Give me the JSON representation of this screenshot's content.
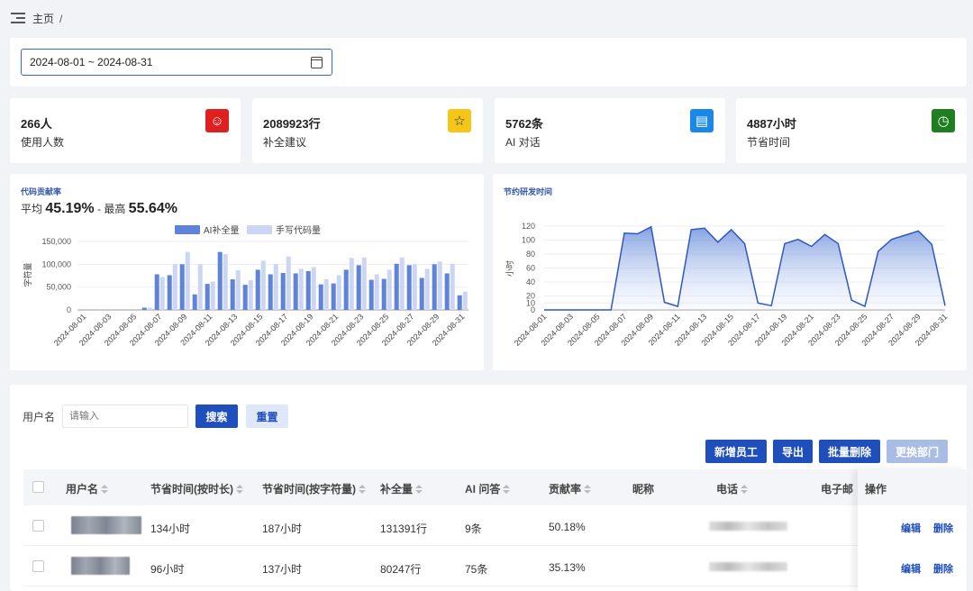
{
  "breadcrumb": {
    "home": "主页",
    "separator": "/"
  },
  "date_range": "2024-08-01 ~ 2024-08-31",
  "stats": [
    {
      "value": "266人",
      "label": "使用人数",
      "color": "#e02020",
      "icon": "user-circle-icon",
      "glyph": "☺"
    },
    {
      "value": "2089923行",
      "label": "补全建议",
      "color": "#f5c518",
      "icon": "star-icon",
      "glyph": "☆"
    },
    {
      "value": "5762条",
      "label": "AI 对话",
      "color": "#1a88e8",
      "icon": "chat-icon",
      "glyph": "▤"
    },
    {
      "value": "4887小时",
      "label": "节省时间",
      "color": "#1e7e20",
      "icon": "clock-icon",
      "glyph": "◷"
    }
  ],
  "contribution": {
    "title": "代码贡献率",
    "avg_label": "平均",
    "avg_value": "45.19%",
    "dash": "-",
    "max_label": "最高",
    "max_value": "55.64%"
  },
  "time_saved": {
    "title": "节约研发时间"
  },
  "colors": {
    "primary": "#1f4ebd",
    "bar_ai": "#5f83d9",
    "bar_manual": "#ccd6f3",
    "line": "#2f57c4"
  },
  "chart_data": [
    {
      "type": "bar",
      "categories": [
        "2024-08-01",
        "2024-08-02",
        "2024-08-03",
        "2024-08-04",
        "2024-08-05",
        "2024-08-06",
        "2024-08-07",
        "2024-08-08",
        "2024-08-09",
        "2024-08-10",
        "2024-08-11",
        "2024-08-12",
        "2024-08-13",
        "2024-08-14",
        "2024-08-15",
        "2024-08-16",
        "2024-08-17",
        "2024-08-18",
        "2024-08-19",
        "2024-08-20",
        "2024-08-21",
        "2024-08-22",
        "2024-08-23",
        "2024-08-24",
        "2024-08-25",
        "2024-08-26",
        "2024-08-27",
        "2024-08-28",
        "2024-08-29",
        "2024-08-30",
        "2024-08-31"
      ],
      "tick_labels": [
        "2024-08-01",
        "2024-08-03",
        "2024-08-05",
        "2024-08-07",
        "2024-08-09",
        "2024-08-11",
        "2024-08-13",
        "2024-08-15",
        "2024-08-17",
        "2024-08-19",
        "2024-08-21",
        "2024-08-23",
        "2024-08-25",
        "2024-08-27",
        "2024-08-29",
        "2024-08-31"
      ],
      "series": [
        {
          "name": "AI补全量",
          "values": [
            0,
            0,
            0,
            0,
            0,
            5000,
            78000,
            76000,
            100000,
            34000,
            57000,
            127000,
            67000,
            55000,
            88000,
            78000,
            81000,
            80000,
            85000,
            56000,
            58000,
            88000,
            98000,
            66000,
            68000,
            101000,
            98000,
            70000,
            100000,
            80000,
            32000
          ]
        },
        {
          "name": "手写代码量",
          "values": [
            0,
            0,
            0,
            0,
            0,
            5000,
            72000,
            100000,
            127000,
            100000,
            62000,
            122000,
            87000,
            65000,
            108000,
            100000,
            117000,
            90000,
            94000,
            67000,
            76000,
            114000,
            115000,
            78000,
            88000,
            115000,
            100000,
            90000,
            106000,
            101000,
            40000
          ]
        }
      ],
      "ylabel": "字符量",
      "yticks": [
        "0",
        "50,000",
        "100,000",
        "150,000"
      ],
      "ylim": [
        0,
        150000
      ]
    },
    {
      "type": "area",
      "x": [
        "2024-08-01",
        "2024-08-02",
        "2024-08-03",
        "2024-08-04",
        "2024-08-05",
        "2024-08-06",
        "2024-08-07",
        "2024-08-08",
        "2024-08-09",
        "2024-08-10",
        "2024-08-11",
        "2024-08-12",
        "2024-08-13",
        "2024-08-14",
        "2024-08-15",
        "2024-08-16",
        "2024-08-17",
        "2024-08-18",
        "2024-08-19",
        "2024-08-20",
        "2024-08-21",
        "2024-08-22",
        "2024-08-23",
        "2024-08-24",
        "2024-08-25",
        "2024-08-26",
        "2024-08-27",
        "2024-08-28",
        "2024-08-29",
        "2024-08-30",
        "2024-08-31"
      ],
      "tick_labels": [
        "2024-08-01",
        "2024-08-03",
        "2024-08-05",
        "2024-08-07",
        "2024-08-09",
        "2024-08-11",
        "2024-08-13",
        "2024-08-15",
        "2024-08-17",
        "2024-08-19",
        "2024-08-21",
        "2024-08-23",
        "2024-08-25",
        "2024-08-27",
        "2024-08-29",
        "2024-08-31"
      ],
      "series": [
        {
          "values": [
            0,
            0,
            0,
            0,
            0,
            0,
            110,
            109,
            119,
            11,
            5,
            115,
            117,
            97,
            115,
            95,
            10,
            6,
            95,
            101,
            91,
            108,
            95,
            14,
            5,
            84,
            101,
            107,
            113,
            94,
            6
          ]
        }
      ],
      "ylabel": "小时",
      "yticks": [
        "0",
        "10",
        "20",
        "40",
        "60",
        "80",
        "100",
        "120"
      ],
      "ylim": [
        0,
        120
      ]
    }
  ],
  "search": {
    "label": "用户名",
    "placeholder": "请输入",
    "search_btn": "搜索",
    "reset_btn": "重置"
  },
  "actions": {
    "add": "新增员工",
    "export": "导出",
    "batch_delete": "批量删除",
    "change_dept": "更换部门"
  },
  "table": {
    "columns": {
      "username": "用户名",
      "time_by_duration": "节省时间(按时长)",
      "time_by_chars": "节省时间(按字符量)",
      "completion": "补全量",
      "ai_qa": "AI 问答",
      "contribution": "贡献率",
      "nickname": "昵称",
      "phone": "电话",
      "email": "电子邮",
      "ops": "操作"
    },
    "rows": [
      {
        "time_by_duration": "134小时",
        "time_by_chars": "187小时",
        "completion": "131391行",
        "ai_qa": "9条",
        "contribution": "50.18%",
        "edit": "编辑",
        "delete": "删除"
      },
      {
        "time_by_duration": "96小时",
        "time_by_chars": "137小时",
        "completion": "80247行",
        "ai_qa": "75条",
        "contribution": "35.13%",
        "edit": "编辑",
        "delete": "删除"
      }
    ]
  }
}
